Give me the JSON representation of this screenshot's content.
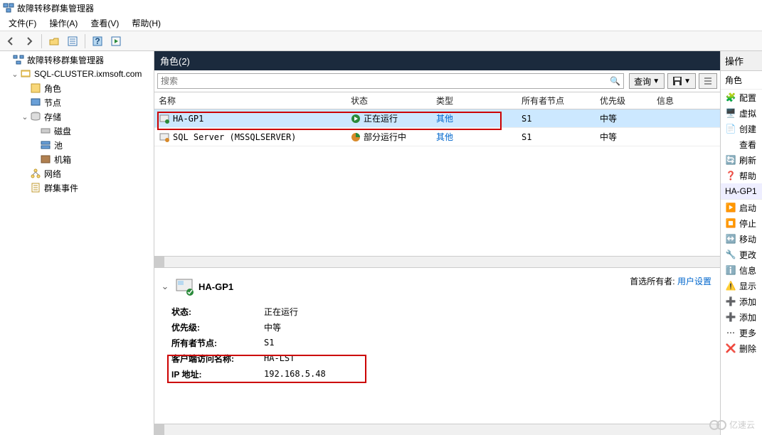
{
  "app": {
    "title": "故障转移群集管理器"
  },
  "menu": {
    "file": "文件(F)",
    "action": "操作(A)",
    "view": "查看(V)",
    "help": "帮助(H)"
  },
  "tree": {
    "root": "故障转移群集管理器",
    "cluster": "SQL-CLUSTER.ixmsoft.com",
    "roles": "角色",
    "nodes": "节点",
    "storage": "存储",
    "disks": "磁盘",
    "pools": "池",
    "enclosures": "机箱",
    "networks": "网络",
    "events": "群集事件"
  },
  "panel": {
    "title": "角色(2)"
  },
  "search": {
    "placeholder": "搜索",
    "query": "查询"
  },
  "grid": {
    "head": {
      "name": "名称",
      "status": "状态",
      "type": "类型",
      "owner": "所有者节点",
      "priority": "优先级",
      "info": "信息"
    },
    "rows": [
      {
        "name": "HA-GP1",
        "status": "正在运行",
        "type": "其他",
        "owner": "S1",
        "priority": "中等",
        "info": "",
        "status_kind": "running"
      },
      {
        "name": "SQL Server (MSSQLSERVER)",
        "status": "部分运行中",
        "type": "其他",
        "owner": "S1",
        "priority": "中等",
        "info": "",
        "status_kind": "partial"
      }
    ]
  },
  "detail": {
    "title": "HA-GP1",
    "rows": {
      "status_k": "状态:",
      "status_v": "正在运行",
      "priority_k": "优先级:",
      "priority_v": "中等",
      "owner_k": "所有者节点:",
      "owner_v": "S1",
      "clientname_k": "客户端访问名称:",
      "clientname_v": "HA-LST",
      "ip_k": "IP 地址:",
      "ip_v": "192.168.5.48"
    },
    "pref_owner_label": "首选所有者:",
    "pref_owner_value": "用户设置"
  },
  "actions": {
    "header": "操作",
    "section1": "角色",
    "cfg": "配置",
    "vm": "虚拟",
    "create": "创建",
    "view": "查看",
    "refresh": "刷新",
    "help": "帮助",
    "section2": "HA-GP1",
    "start": "启动",
    "stop": "停止",
    "move": "移动",
    "change": "更改",
    "info": "信息",
    "crit": "显示",
    "add_res": "添加",
    "add_store": "添加",
    "more": "更多",
    "delete": "删除"
  },
  "watermark": "亿速云"
}
